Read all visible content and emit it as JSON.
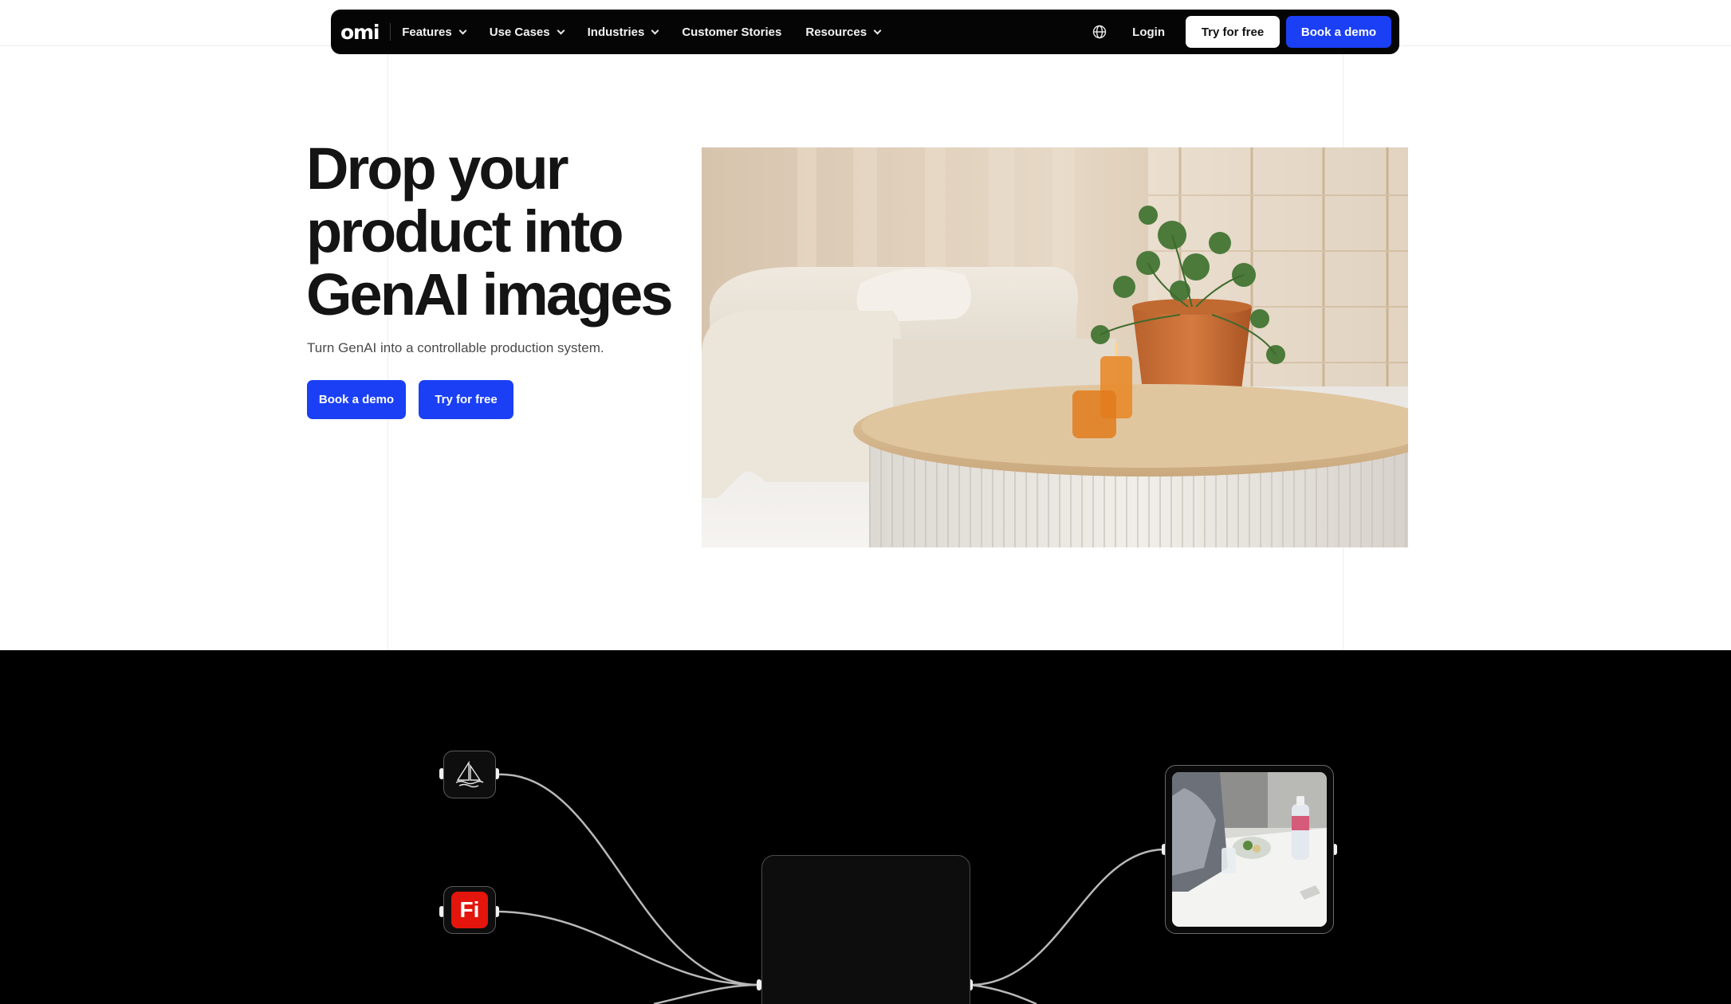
{
  "nav": {
    "logo": "omi",
    "items": [
      {
        "label": "Features",
        "dropdown": true
      },
      {
        "label": "Use Cases",
        "dropdown": true
      },
      {
        "label": "Industries",
        "dropdown": true
      },
      {
        "label": "Customer Stories",
        "dropdown": false
      },
      {
        "label": "Resources",
        "dropdown": true
      }
    ],
    "globe_icon": "globe-icon",
    "login": "Login",
    "try_free": "Try for free",
    "book_demo": "Book a demo"
  },
  "hero": {
    "title": "Drop your product into GenAI images",
    "subtitle": "Turn GenAI into a controllable production system.",
    "primary_button": "Book a demo",
    "secondary_button": "Try for free"
  },
  "workflow": {
    "sources": [
      {
        "name": "midjourney",
        "icon": "sailboat-icon"
      },
      {
        "name": "firefly",
        "icon": "firefly-icon",
        "label": "Fi"
      }
    ]
  },
  "colors": {
    "accent": "#1a3ff5",
    "nav_bg": "#050505",
    "dark_section": "#000000"
  }
}
